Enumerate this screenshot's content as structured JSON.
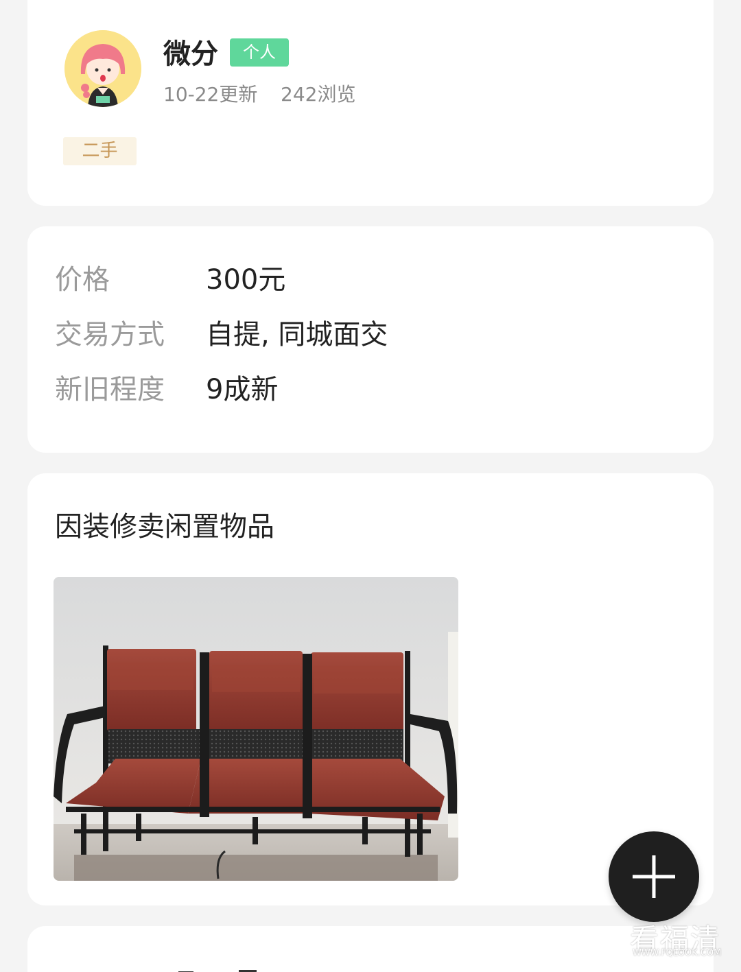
{
  "profile": {
    "user_name": "微分",
    "badge": "个人",
    "updated": "10-22更新",
    "views": "242浏览",
    "tag": "二手",
    "avatar_icon": "cartoon-girl-avatar-icon"
  },
  "details": {
    "rows": [
      {
        "label": "价格",
        "value": "300元"
      },
      {
        "label": "交易方式",
        "value": "自提, 同城面交"
      },
      {
        "label": "新旧程度",
        "value": "9成新"
      }
    ]
  },
  "description": {
    "text": "因装修卖闲置物品",
    "photo_subject": "three-seat-leather-bench-photo"
  },
  "fab": {
    "icon": "plus-icon"
  },
  "watermark": {
    "main": "看福清",
    "sub": "WWW.FQLOOK.COM"
  },
  "colors": {
    "badge_green": "#5fd79b",
    "tag_bg": "#faf3e4",
    "tag_text": "#c69656",
    "fab_bg": "#1f1f1f"
  }
}
